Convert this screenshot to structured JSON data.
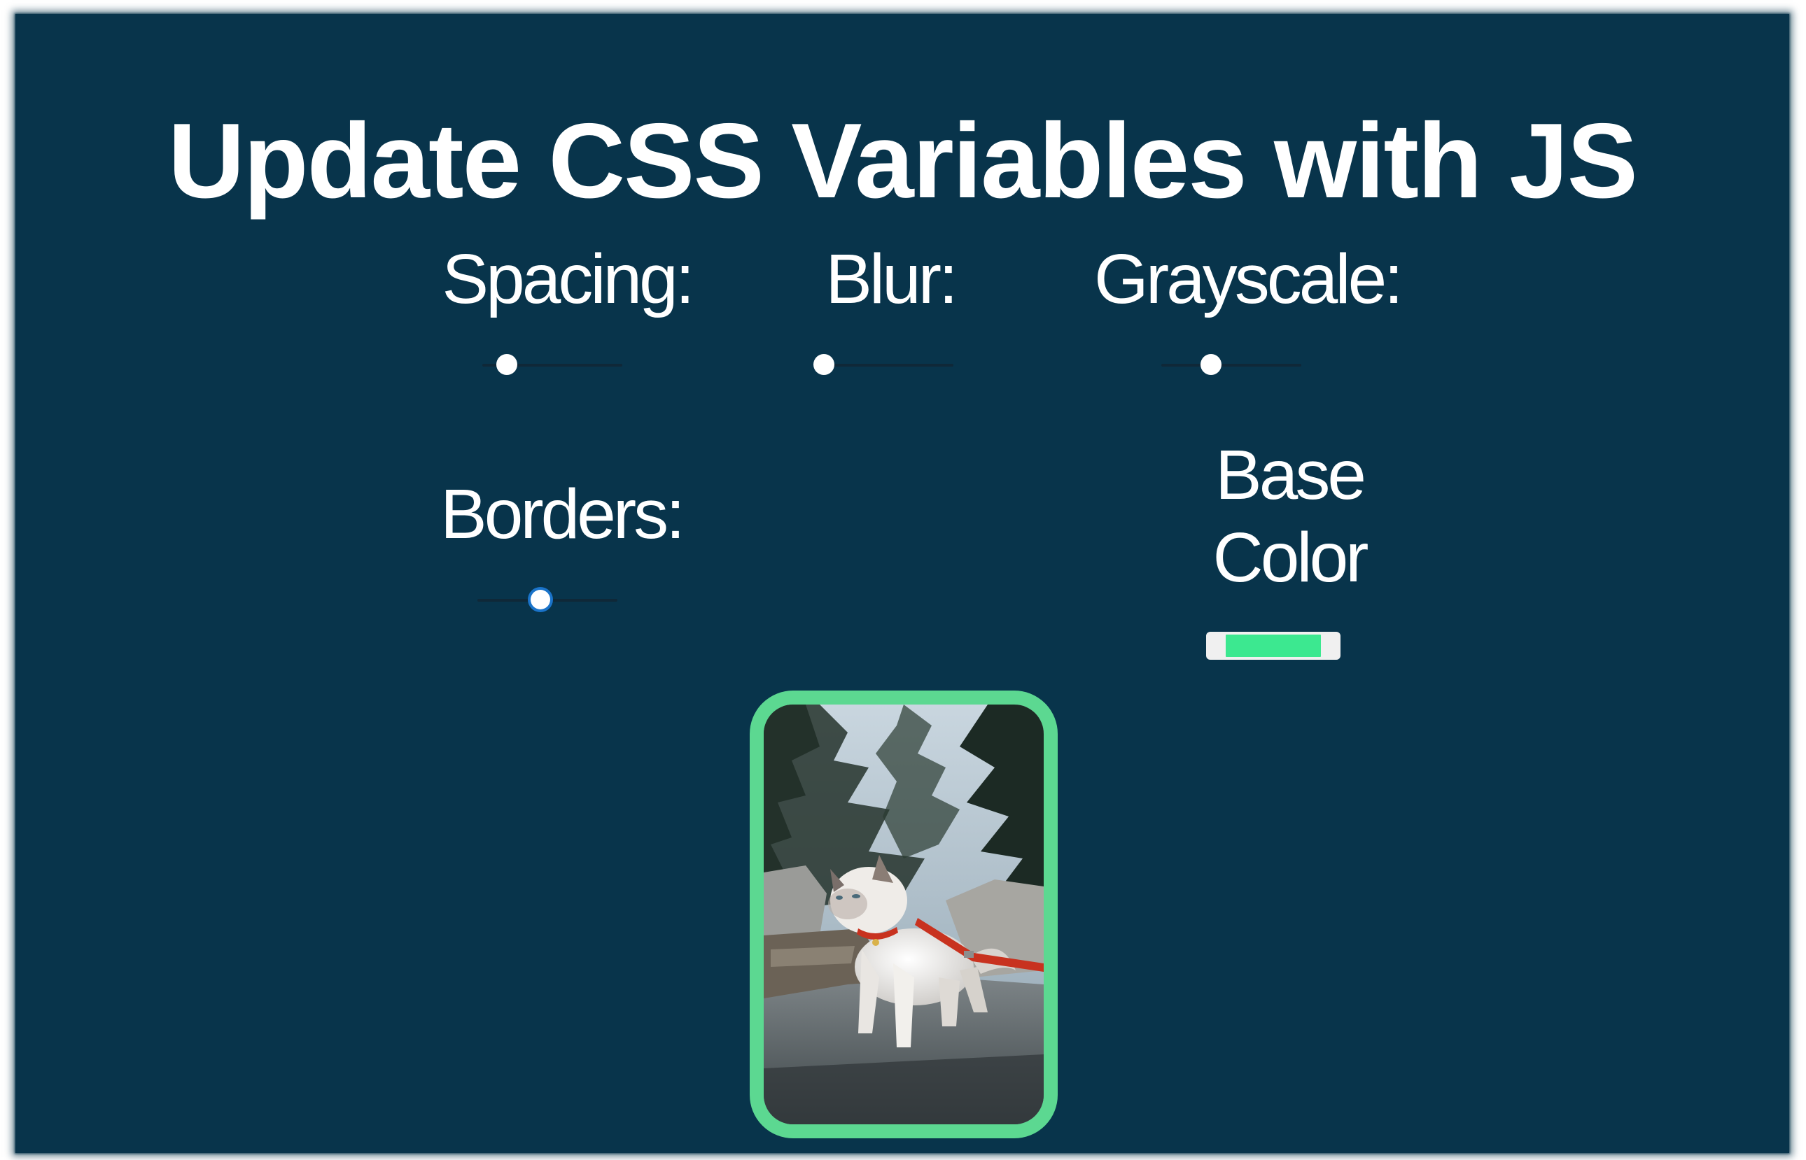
{
  "page": {
    "title": "Update CSS Variables with JS"
  },
  "controls": {
    "spacing": {
      "label": "Spacing:",
      "value_fraction": 0.12
    },
    "blur": {
      "label": "Blur:",
      "value_fraction": 0.0
    },
    "grayscale": {
      "label": "Grayscale:",
      "value_fraction": 0.33
    },
    "borders": {
      "label": "Borders:",
      "value_fraction": 0.44
    },
    "base_color": {
      "label_line1": "Base",
      "label_line2": "Color",
      "value": "#3ce890"
    }
  },
  "image": {
    "subject": "cat-on-leash-photo",
    "border_color": "#5cd891"
  },
  "colors": {
    "background": "#08344b",
    "text": "#ffffff",
    "accent": "#5cd891",
    "focus_ring": "#1a73c9"
  }
}
